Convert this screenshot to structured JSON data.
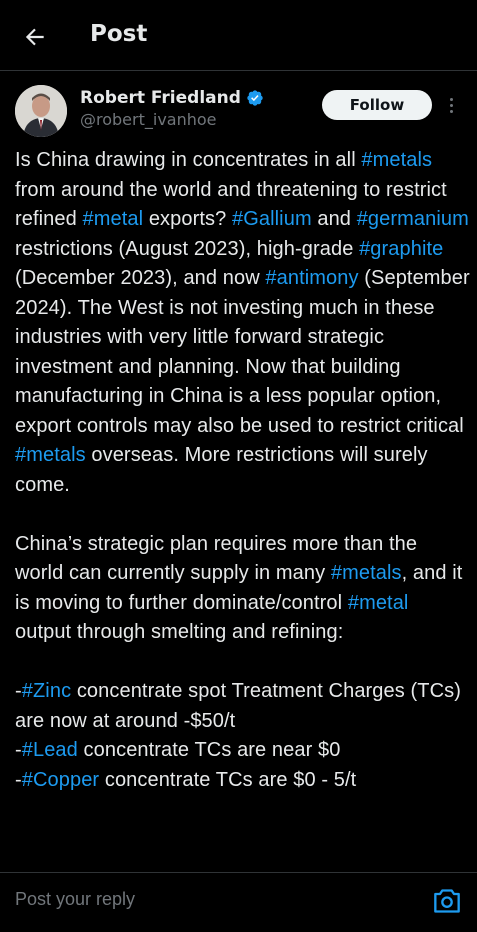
{
  "header": {
    "title": "Post",
    "back_icon": "arrow-left-icon"
  },
  "author": {
    "name": "Robert Friedland",
    "handle": "@robert_ivanhoe",
    "verified": true,
    "follow_label": "Follow"
  },
  "post": {
    "p1": [
      {
        "t": "Is China drawing in concentrates in all "
      },
      {
        "t": "#metals",
        "tag": true
      },
      {
        "t": " from around the world and threatening to restrict refined "
      },
      {
        "t": "#metal",
        "tag": true
      },
      {
        "t": " exports? "
      },
      {
        "t": "#Gallium",
        "tag": true
      },
      {
        "t": " and "
      },
      {
        "t": "#germanium",
        "tag": true
      },
      {
        "t": " restrictions (August 2023), high-grade "
      },
      {
        "t": "#graphite",
        "tag": true
      },
      {
        "t": " (December 2023), and now "
      },
      {
        "t": "#antimony",
        "tag": true
      },
      {
        "t": " (September 2024). The West is not investing much in these industries with very little forward strategic investment and planning. Now that building manufacturing in China is a less popular option, export controls may also be used to restrict critical "
      },
      {
        "t": "#metals",
        "tag": true
      },
      {
        "t": " overseas. More restrictions will surely come."
      }
    ],
    "p2": [
      {
        "t": "China’s strategic plan requires more than the world can currently supply in many "
      },
      {
        "t": "#metals",
        "tag": true
      },
      {
        "t": ", and it is moving to further dominate/control "
      },
      {
        "t": "#metal",
        "tag": true
      },
      {
        "t": " output through smelting and refining:"
      }
    ],
    "p3": [
      {
        "t": "-"
      },
      {
        "t": "#Zinc",
        "tag": true
      },
      {
        "t": " concentrate spot Treatment Charges (TCs) are now at around -$50/t"
      }
    ],
    "p4": [
      {
        "t": "-"
      },
      {
        "t": "#Lead",
        "tag": true
      },
      {
        "t": " concentrate TCs are near $0"
      }
    ],
    "p5": [
      {
        "t": "-"
      },
      {
        "t": "#Copper",
        "tag": true
      },
      {
        "t": " concentrate TCs are $0 - 5/t"
      }
    ]
  },
  "reply": {
    "placeholder": "Post your reply",
    "camera_icon": "camera-icon"
  },
  "colors": {
    "background": "#000000",
    "text": "#e7e9ea",
    "link": "#1d9bf0",
    "muted": "#71767b"
  }
}
